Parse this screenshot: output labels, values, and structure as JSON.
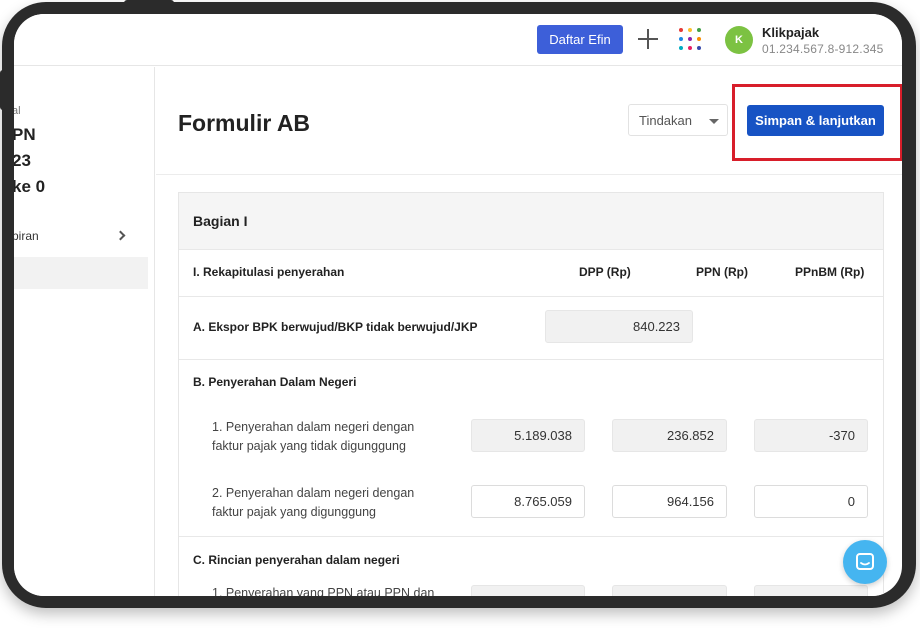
{
  "topbar": {
    "daftar_efin_label": "Daftar Efin",
    "avatar_initial": "K",
    "user_name": "Klikpajak",
    "user_npwp": "01.234.567.8-912.345",
    "grid_colors": [
      "#e53935",
      "#fbc02d",
      "#43a047",
      "#1e88e5",
      "#8e24aa",
      "#fb8c00",
      "#00acc1",
      "#e91e63",
      "#3949ab"
    ]
  },
  "sidebar": {
    "line1": "al",
    "line2": "PN",
    "line3": "23",
    "line4": "ke 0",
    "item_label": "piran"
  },
  "main": {
    "title": "Formulir AB",
    "tindakan_label": "Tindakan",
    "save_label": "Simpan & lanjutkan"
  },
  "form": {
    "section_title": "Bagian I",
    "header_label": "I. Rekapitulasi penyerahan",
    "columns": [
      "DPP (Rp)",
      "PPN (Rp)",
      "PPnBM (Rp)"
    ],
    "row_a": {
      "label": "A. Ekspor BPK berwujud/BKP tidak berwujud/JKP",
      "dpp": "840.223"
    },
    "section_b": "B. Penyerahan Dalam Negeri",
    "row_b1": {
      "label_line1": "1. Penyerahan dalam negeri dengan",
      "label_line2": "faktur pajak yang tidak digunggung",
      "dpp": "5.189.038",
      "ppn": "236.852",
      "ppnbm": "-370"
    },
    "row_b2": {
      "label_line1": "2. Penyerahan dalam negeri dengan",
      "label_line2": "faktur pajak yang digunggung",
      "dpp": "8.765.059",
      "ppn": "964.156",
      "ppnbm": "0"
    },
    "section_c": "C. Rincian penyerahan dalam negeri",
    "row_c1": {
      "label_line1": "1. Penyerahan yang PPN atau PPN dan"
    }
  },
  "colors": {
    "primary": "#1753c4",
    "efin": "#3d5fd9",
    "highlight": "#d81e2a",
    "avatar": "#7cc242",
    "chat": "#45b5f0"
  },
  "icons": {
    "plus": "plus-icon",
    "apps": "apps-grid-icon",
    "chevron": "chevron-right-icon",
    "caret": "caret-down-icon",
    "chat": "chat-icon"
  }
}
